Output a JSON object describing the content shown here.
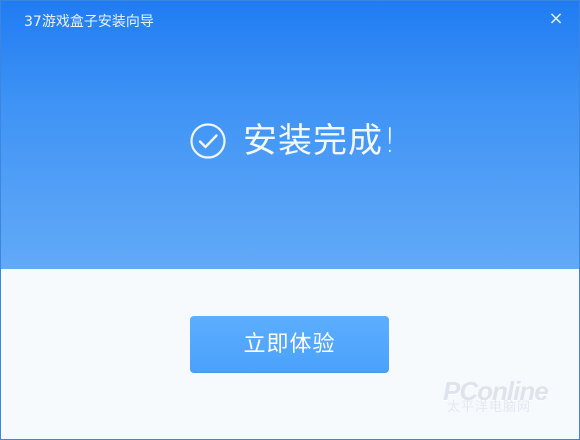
{
  "window": {
    "title": "37游戏盒子安装向导",
    "close_label": "×"
  },
  "status": {
    "message": "安装完成!",
    "icon": "check-circle-icon"
  },
  "action": {
    "button_label": "立即体验"
  },
  "watermark": {
    "brand": "PConline",
    "subtitle": "太平洋电脑网"
  },
  "colors": {
    "header_gradient_top": "#1f7cf2",
    "header_gradient_bottom": "#62aaf7",
    "content_bg": "#f7fafd",
    "button_bg": "#4aa1fb",
    "button_text": "#ffffff"
  }
}
